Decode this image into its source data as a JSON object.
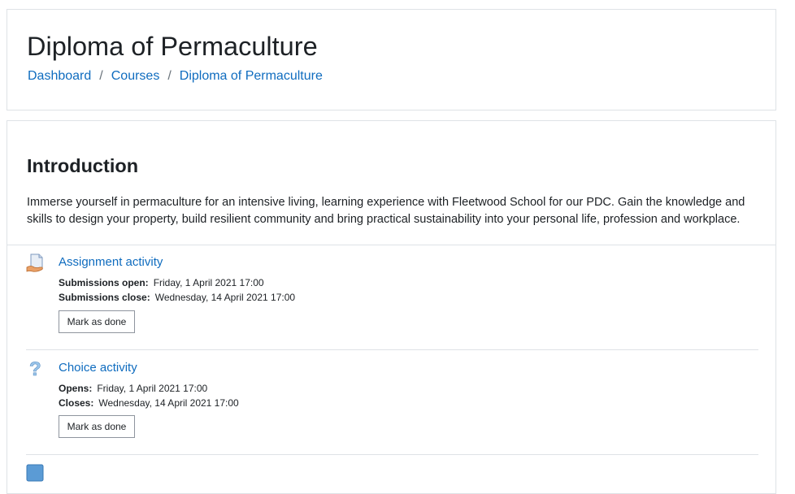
{
  "header": {
    "title": "Diploma of Permaculture",
    "breadcrumb": [
      {
        "label": "Dashboard"
      },
      {
        "label": "Courses"
      },
      {
        "label": "Diploma of Permaculture"
      }
    ],
    "separator": "/"
  },
  "section": {
    "title": "Introduction",
    "summary": "Immerse yourself in permaculture for an intensive living, learning experience with Fleetwood School for our PDC. Gain the knowledge and skills to design your property, build resilient community and bring practical sustainability into your personal life, profession and workplace."
  },
  "activities": [
    {
      "icon": "assignment-icon",
      "name": "Assignment activity",
      "dates": [
        {
          "label": "Submissions open:",
          "value": "Friday, 1 April 2021 17:00"
        },
        {
          "label": "Submissions close:",
          "value": "Wednesday, 14 April 2021 17:00"
        }
      ],
      "button": "Mark as done"
    },
    {
      "icon": "choice-icon",
      "name": "Choice activity",
      "dates": [
        {
          "label": "Opens:",
          "value": "Friday, 1 April 2021 17:00"
        },
        {
          "label": "Closes:",
          "value": "Wednesday, 14 April 2021 17:00"
        }
      ],
      "button": "Mark as done"
    },
    {
      "icon": "activity-icon"
    }
  ],
  "colors": {
    "link": "#0f6cbf",
    "border": "#dee2e6",
    "text": "#1d2125"
  }
}
